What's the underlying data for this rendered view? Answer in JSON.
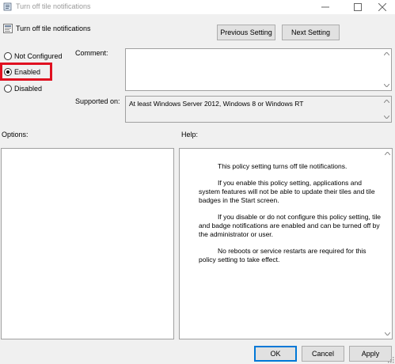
{
  "window": {
    "title": "Turn off tile notifications",
    "minimize_glyph": "─",
    "maximize_glyph": "☐",
    "close_glyph": "✕"
  },
  "header": {
    "policy_title": "Turn off tile notifications",
    "prev_button": "Previous Setting",
    "next_button": "Next Setting"
  },
  "state": {
    "options": [
      {
        "label": "Not Configured",
        "checked": false
      },
      {
        "label": "Enabled",
        "checked": true
      },
      {
        "label": "Disabled",
        "checked": false
      }
    ]
  },
  "comment": {
    "label": "Comment:",
    "value": ""
  },
  "supported": {
    "label": "Supported on:",
    "value": "At least Windows Server 2012, Windows 8 or Windows RT"
  },
  "panels": {
    "options_label": "Options:",
    "help_label": "Help:",
    "help_paragraphs": [
      "This policy setting turns off tile notifications.",
      "If you enable this policy setting, applications and system features will not be able to update their tiles and tile badges in the Start screen.",
      "If you disable or do not configure this policy setting, tile and badge notifications are enabled and can be turned off by the administrator or user.",
      "No reboots or service restarts are required for this policy setting to take effect."
    ]
  },
  "footer": {
    "ok": "OK",
    "cancel": "Cancel",
    "apply": "Apply"
  },
  "colors": {
    "highlight": "#e01020",
    "focus_border": "#0078d7"
  }
}
